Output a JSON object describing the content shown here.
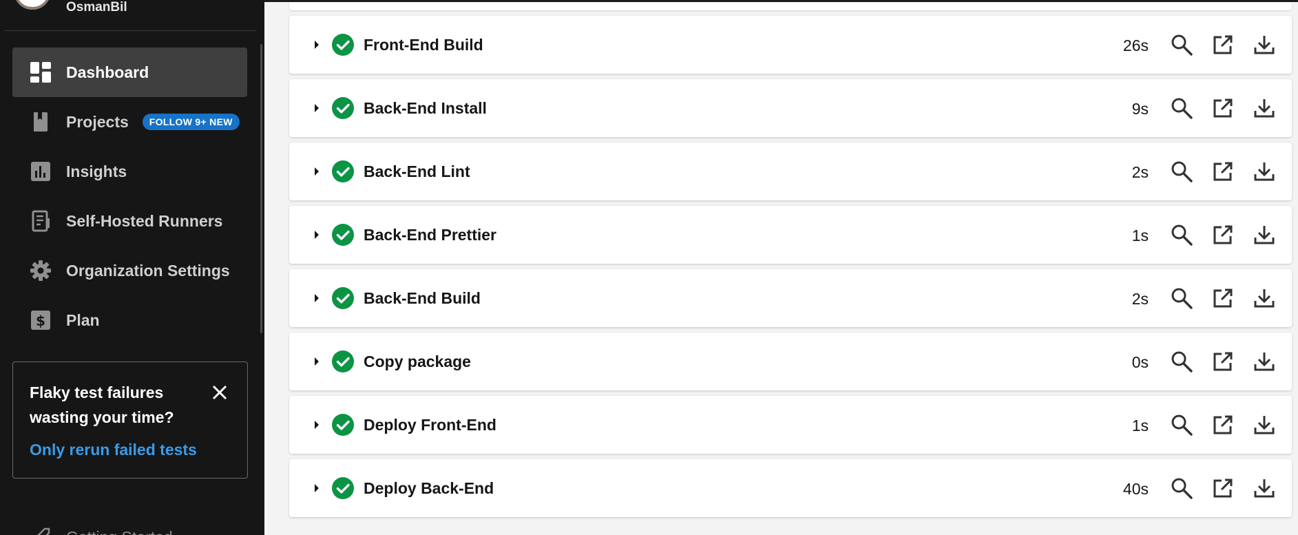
{
  "user": {
    "name": "OsmanBil"
  },
  "sidebar": {
    "items": [
      {
        "label": "Dashboard",
        "icon": "dashboard-icon",
        "active": true
      },
      {
        "label": "Projects",
        "icon": "book-icon",
        "badge": "FOLLOW 9+ NEW"
      },
      {
        "label": "Insights",
        "icon": "bar-chart-icon"
      },
      {
        "label": "Self-Hosted Runners",
        "icon": "runner-icon"
      },
      {
        "label": "Organization Settings",
        "icon": "gear-icon"
      },
      {
        "label": "Plan",
        "icon": "dollar-icon"
      }
    ],
    "promo": {
      "title": "Flaky test failures wasting your time?",
      "link": "Only rerun failed tests"
    },
    "getting_started": "Getting Started"
  },
  "jobs": [
    {
      "name": "Front-End Build",
      "duration": "26s",
      "status": "success"
    },
    {
      "name": "Back-End Install",
      "duration": "9s",
      "status": "success"
    },
    {
      "name": "Back-End Lint",
      "duration": "2s",
      "status": "success"
    },
    {
      "name": "Back-End Prettier",
      "duration": "1s",
      "status": "success"
    },
    {
      "name": "Back-End Build",
      "duration": "2s",
      "status": "success"
    },
    {
      "name": "Copy package",
      "duration": "0s",
      "status": "success"
    },
    {
      "name": "Deploy Front-End",
      "duration": "1s",
      "status": "success"
    },
    {
      "name": "Deploy Back-End",
      "duration": "40s",
      "status": "success"
    }
  ],
  "colors": {
    "sidebar_bg": "#161616",
    "active_item_bg": "#3f3f3f",
    "badge_bg": "#1673c8",
    "link": "#3b9be8",
    "success": "#0b9444",
    "main_bg": "#f3f3f3"
  }
}
